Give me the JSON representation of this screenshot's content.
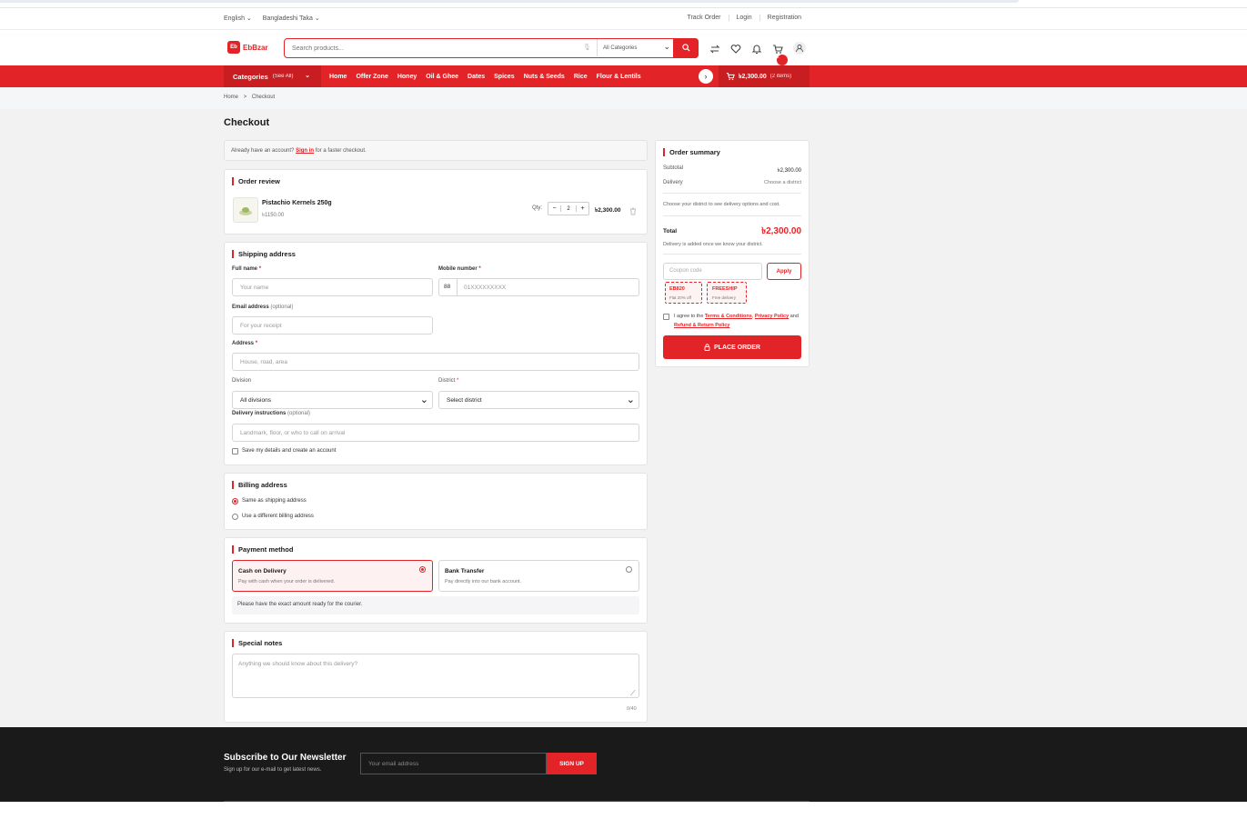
{
  "topbar": {
    "language": "English",
    "currency": "Bangladeshi Taka",
    "links": [
      "Track Order",
      "Login",
      "Registration"
    ]
  },
  "header": {
    "logo_mark": "Eb",
    "logo_text": "EbBzar",
    "search_placeholder": "Search products...",
    "category_select": "All Categories",
    "cart_count": "2"
  },
  "nav": {
    "categories_label": "Categories",
    "see_all": "(See All)",
    "items": [
      "Home",
      "Offer Zone",
      "Honey",
      "Oil & Ghee",
      "Dates",
      "Spices",
      "Nuts & Seeds",
      "Rice",
      "Flour & Lentils"
    ],
    "cart_total": "৳2,300.00",
    "cart_items": "(2 items)"
  },
  "breadcrumb": {
    "home": "Home",
    "sep": ">",
    "current": "Checkout"
  },
  "page_title": "Checkout",
  "signin": {
    "prefix": "Already have an account?",
    "link": "Sign in",
    "suffix": "for a faster checkout."
  },
  "order_review": {
    "title": "Order review",
    "product_name": "Pistachio Kernels 250g",
    "unit_price": "৳1150.00",
    "qty_label": "Qty:",
    "qty": "2",
    "line_total": "৳2,300.00"
  },
  "shipping": {
    "title": "Shipping address",
    "full_name_label": "Full name",
    "full_name_placeholder": "Your name",
    "mobile_label": "Mobile number",
    "mobile_prefix": "88",
    "mobile_placeholder": "01XXXXXXXXX",
    "email_label": "Email address",
    "email_optional": "(optional)",
    "email_placeholder": "For your receipt",
    "address_label": "Address",
    "address_placeholder": "House, road, area",
    "division_label": "Division",
    "division_value": "All divisions",
    "district_label": "District",
    "district_value": "Select district",
    "instructions_label": "Delivery instructions",
    "instructions_optional": "(optional)",
    "instructions_placeholder": "Landmark, floor, or who to call on arrival",
    "save_details": "Save my details and create an account",
    "req": "*"
  },
  "billing": {
    "title": "Billing address",
    "same": "Same as shipping address",
    "different": "Use a different billing address"
  },
  "payment": {
    "title": "Payment method",
    "cod_title": "Cash on Delivery",
    "cod_desc": "Pay with cash when your order is delivered.",
    "bank_title": "Bank Transfer",
    "bank_desc": "Pay directly into our bank account.",
    "note": "Please have the exact amount ready for the courier."
  },
  "notes": {
    "title": "Special notes",
    "placeholder": "Anything we should know about this delivery?",
    "counter": "0/40"
  },
  "summary": {
    "title": "Order summary",
    "subtotal_label": "Subtotal",
    "subtotal": "৳2,300.00",
    "delivery_label": "Delivery",
    "delivery_value": "Choose a district",
    "district_hint": "Choose your district to see delivery options and cost.",
    "total_label": "Total",
    "total": "৳2,300.00",
    "total_note": "Delivery is added once we know your district.",
    "coupon_placeholder": "Coupon code",
    "apply": "Apply",
    "coupons": [
      {
        "code": "EB820",
        "desc": "Flat 20% off"
      },
      {
        "code": "FREESHIP",
        "desc": "Free delivery"
      }
    ],
    "agree_prefix": "I agree to the",
    "terms": "Terms & Conditions",
    "comma": ",",
    "privacy": "Privacy Policy",
    "and": "and",
    "refund": "Refund & Return Policy",
    "place_order": "PLACE ORDER"
  },
  "footer": {
    "title": "Subscribe to Our Newsletter",
    "subtitle": "Sign up for our e-mail to get latest news.",
    "email_placeholder": "Your email address",
    "signup": "SIGN UP"
  },
  "colors": {
    "accent": "#e22428",
    "dark": "#1a1a1a"
  }
}
